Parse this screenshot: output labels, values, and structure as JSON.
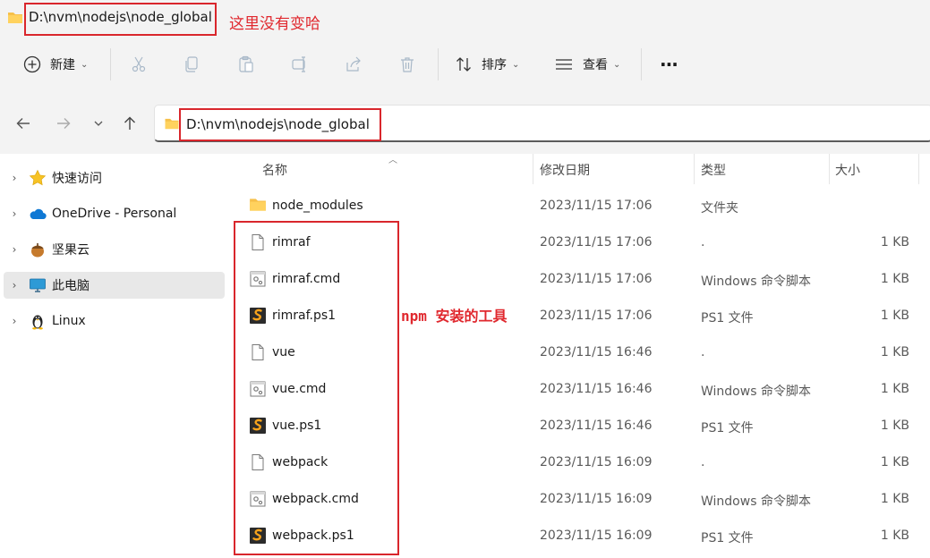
{
  "window": {
    "title_path": "D:\\nvm\\nodejs\\node_global",
    "title_annotation": "这里没有变哈"
  },
  "toolbar": {
    "new_label": "新建",
    "sort_label": "排序",
    "view_label": "查看",
    "more_label": "···"
  },
  "address": {
    "path": "D:\\nvm\\nodejs\\node_global"
  },
  "sidebar": {
    "items": [
      {
        "label": "快速访问",
        "icon": "star-icon"
      },
      {
        "label": "OneDrive - Personal",
        "icon": "onedrive-cloud-icon"
      },
      {
        "label": "坚果云",
        "icon": "nutstore-icon"
      },
      {
        "label": "此电脑",
        "icon": "computer-icon"
      },
      {
        "label": "Linux",
        "icon": "linux-penguin-icon"
      }
    ]
  },
  "columns": {
    "name": "名称",
    "date": "修改日期",
    "type": "类型",
    "size": "大小"
  },
  "files": [
    {
      "name": "node_modules",
      "date": "2023/11/15 17:06",
      "type": "文件夹",
      "size": "",
      "icon": "folder-icon"
    },
    {
      "name": "rimraf",
      "date": "2023/11/15 17:06",
      "type": ".",
      "size": "1 KB",
      "icon": "file-icon"
    },
    {
      "name": "rimraf.cmd",
      "date": "2023/11/15 17:06",
      "type": "Windows 命令脚本",
      "size": "1 KB",
      "icon": "cmd-script-icon"
    },
    {
      "name": "rimraf.ps1",
      "date": "2023/11/15 17:06",
      "type": "PS1 文件",
      "size": "1 KB",
      "icon": "ps1-file-icon"
    },
    {
      "name": "vue",
      "date": "2023/11/15 16:46",
      "type": ".",
      "size": "1 KB",
      "icon": "file-icon"
    },
    {
      "name": "vue.cmd",
      "date": "2023/11/15 16:46",
      "type": "Windows 命令脚本",
      "size": "1 KB",
      "icon": "cmd-script-icon"
    },
    {
      "name": "vue.ps1",
      "date": "2023/11/15 16:46",
      "type": "PS1 文件",
      "size": "1 KB",
      "icon": "ps1-file-icon"
    },
    {
      "name": "webpack",
      "date": "2023/11/15 16:09",
      "type": ".",
      "size": "1 KB",
      "icon": "file-icon"
    },
    {
      "name": "webpack.cmd",
      "date": "2023/11/15 16:09",
      "type": "Windows 命令脚本",
      "size": "1 KB",
      "icon": "cmd-script-icon"
    },
    {
      "name": "webpack.ps1",
      "date": "2023/11/15 16:09",
      "type": "PS1 文件",
      "size": "1 KB",
      "icon": "ps1-file-icon"
    }
  ],
  "annotations": {
    "npm_tools": "npm 安装的工具"
  },
  "colors": {
    "annotation_red": "#d9262c",
    "folder_yellow": "#f6c04a",
    "ps1_orange": "#f5a21b"
  }
}
